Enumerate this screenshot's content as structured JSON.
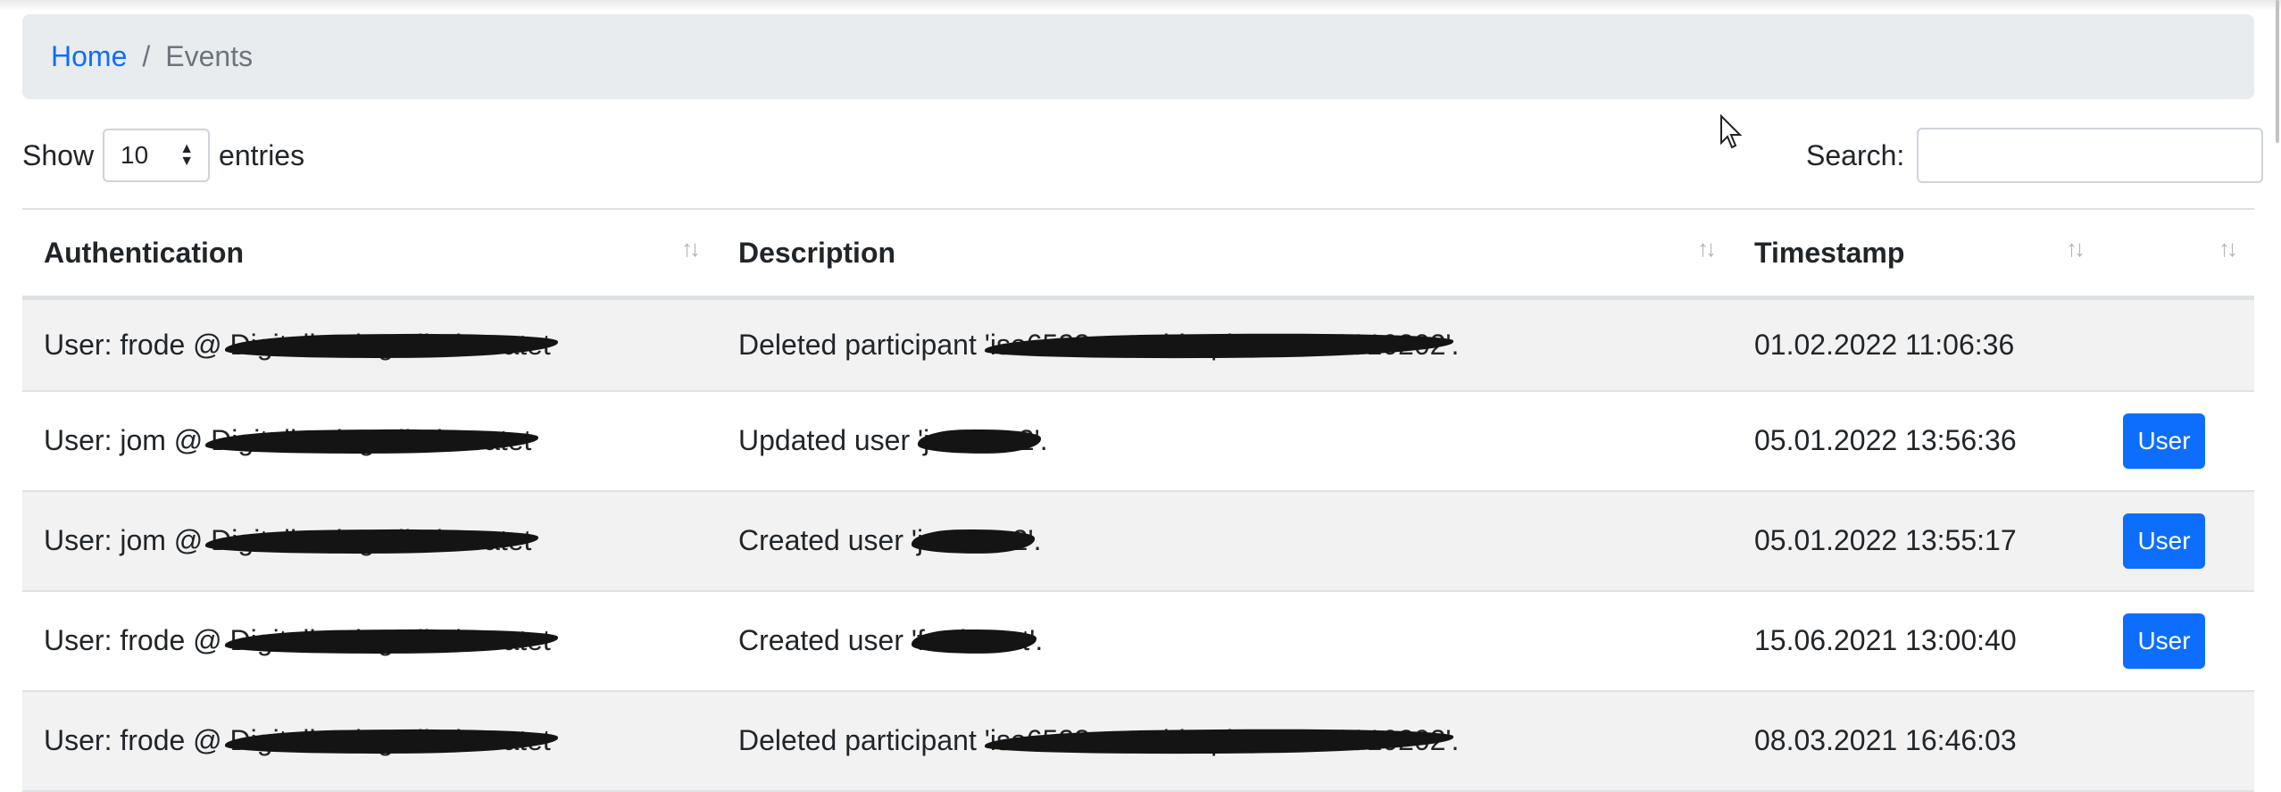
{
  "breadcrumb": {
    "home": "Home",
    "separator": "/",
    "current": "Events"
  },
  "length_control": {
    "show": "Show",
    "value": "10",
    "entries": "entries"
  },
  "search": {
    "label": "Search:",
    "value": ""
  },
  "table": {
    "columns": [
      "Authentication",
      "Description",
      "Timestamp",
      ""
    ],
    "rows": [
      {
        "auth_prefix": "User: frode @ ",
        "auth_redacted": "Digitaliseringsdirektoratet",
        "desc_prefix": "Deleted participant '",
        "desc_redacted": "iso6523-actorid-upis::0192:9910202",
        "desc_suffix": "'.",
        "timestamp": "01.02.2022 11:06:36",
        "action": ""
      },
      {
        "auth_prefix": "User: jom @ ",
        "auth_redacted": "Digitaliseringsdirektoratet",
        "desc_prefix": "Updated user '",
        "desc_redacted": "jm-user2",
        "desc_suffix": "'.",
        "timestamp": "05.01.2022 13:56:36",
        "action": "User"
      },
      {
        "auth_prefix": "User: jom @ ",
        "auth_redacted": "Digitaliseringsdirektoratet",
        "desc_prefix": "Created user '",
        "desc_redacted": "jm-user2",
        "desc_suffix": "'.",
        "timestamp": "05.01.2022 13:55:17",
        "action": "User"
      },
      {
        "auth_prefix": "User: frode @ ",
        "auth_redacted": "Digitaliseringsdirektoratet",
        "desc_prefix": "Created user '",
        "desc_redacted": "froderest",
        "desc_suffix": "'.",
        "timestamp": "15.06.2021 13:00:40",
        "action": "User"
      },
      {
        "auth_prefix": "User: frode @ ",
        "auth_redacted": "Digitaliseringsdirektoratet",
        "desc_prefix": "Deleted participant '",
        "desc_redacted": "iso6523-actorid-upis::0192:9910202",
        "desc_suffix": "'.",
        "timestamp": "08.03.2021 16:46:03",
        "action": ""
      }
    ]
  },
  "colors": {
    "accent": "#0d6efd",
    "breadcrumb_bg": "#e9ecef",
    "row_stripe": "#f2f2f2"
  }
}
